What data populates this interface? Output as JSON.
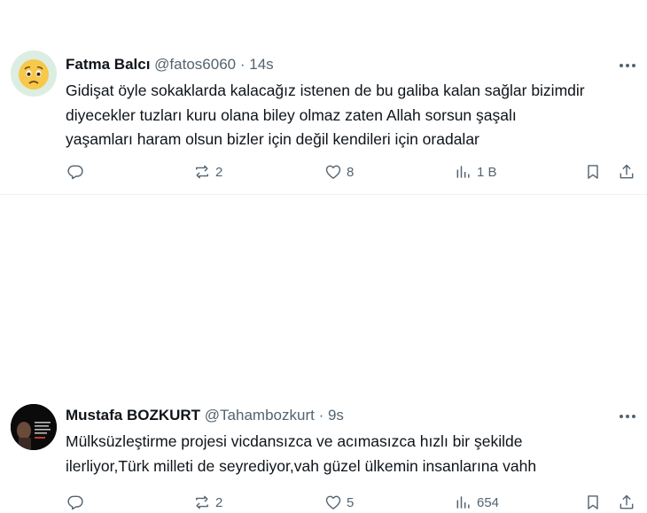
{
  "tweets": [
    {
      "name": "Fatma Balcı",
      "handle": "@fatos6060",
      "separator": "·",
      "time": "14s",
      "avatar_icon": "worried-face-emoji-icon",
      "text_lines": [
        "Gidişat öyle sokaklarda kalacağız istenen de bu galiba kalan sağlar bizimdir",
        "diyecekler  tuzları kuru olana biley olmaz zaten Allah sorsun şaşalı",
        "yaşamları haram olsun bizler için değil kendileri için oradalar"
      ],
      "replies": "",
      "reposts": "2",
      "likes": "8",
      "views": "1 B"
    },
    {
      "name": "Mustafa BOZKURT",
      "handle": "@Tahambozkurt",
      "separator": "·",
      "time": "9s",
      "avatar_icon": "profile-photo",
      "text_lines": [
        "Mülksüzleştirme projesi vicdansızca ve acımasızca hızlı bir şekilde",
        "ilerliyor,Türk milleti de seyrediyor,vah güzel ülkemin insanlarına vahh"
      ],
      "replies": "",
      "reposts": "2",
      "likes": "5",
      "views": "654"
    }
  ],
  "colors": {
    "text": "#0f1419",
    "muted": "#536471",
    "divider": "#eff3f4"
  }
}
